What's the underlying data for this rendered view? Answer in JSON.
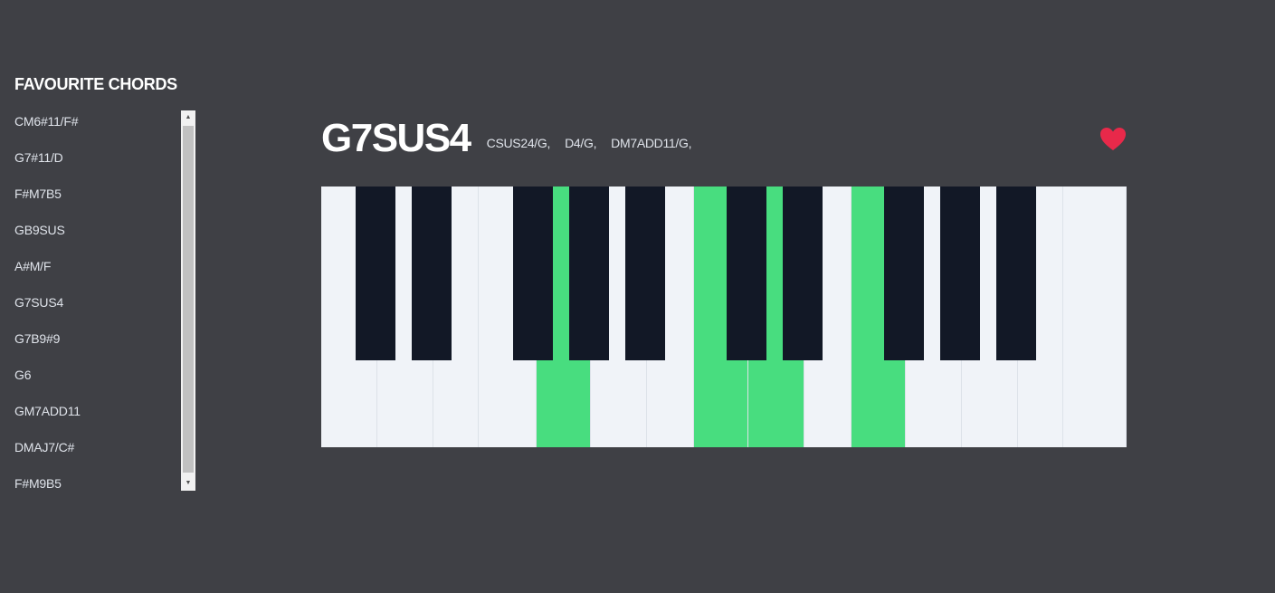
{
  "sidebar": {
    "title": "FAVOURITE CHORDS",
    "chords": [
      "CM6#11/F#",
      "G7#11/D",
      "F#M7B5",
      "GB9SUS",
      "A#M/F",
      "G7SUS4",
      "G7B9#9",
      "G6",
      "GM7ADD11",
      "DMAJ7/C#",
      "F#M9B5"
    ]
  },
  "chord": {
    "name": "G7SUS4",
    "alternates": [
      "CSUS24/G,",
      "D4/G,",
      "DM7ADD11/G,"
    ],
    "favourite_icon": "heart-icon",
    "favourite_color": "#e8294a"
  },
  "keyboard": {
    "active_color": "#48dd7f",
    "white_key_color": "#f0f3f8",
    "black_key_color": "#121826",
    "white_key_count": 15,
    "black_key_count": 10,
    "active_white_keys": [
      4,
      7,
      8,
      10
    ],
    "active_notes": [
      "F",
      "G",
      "C",
      "D"
    ]
  }
}
